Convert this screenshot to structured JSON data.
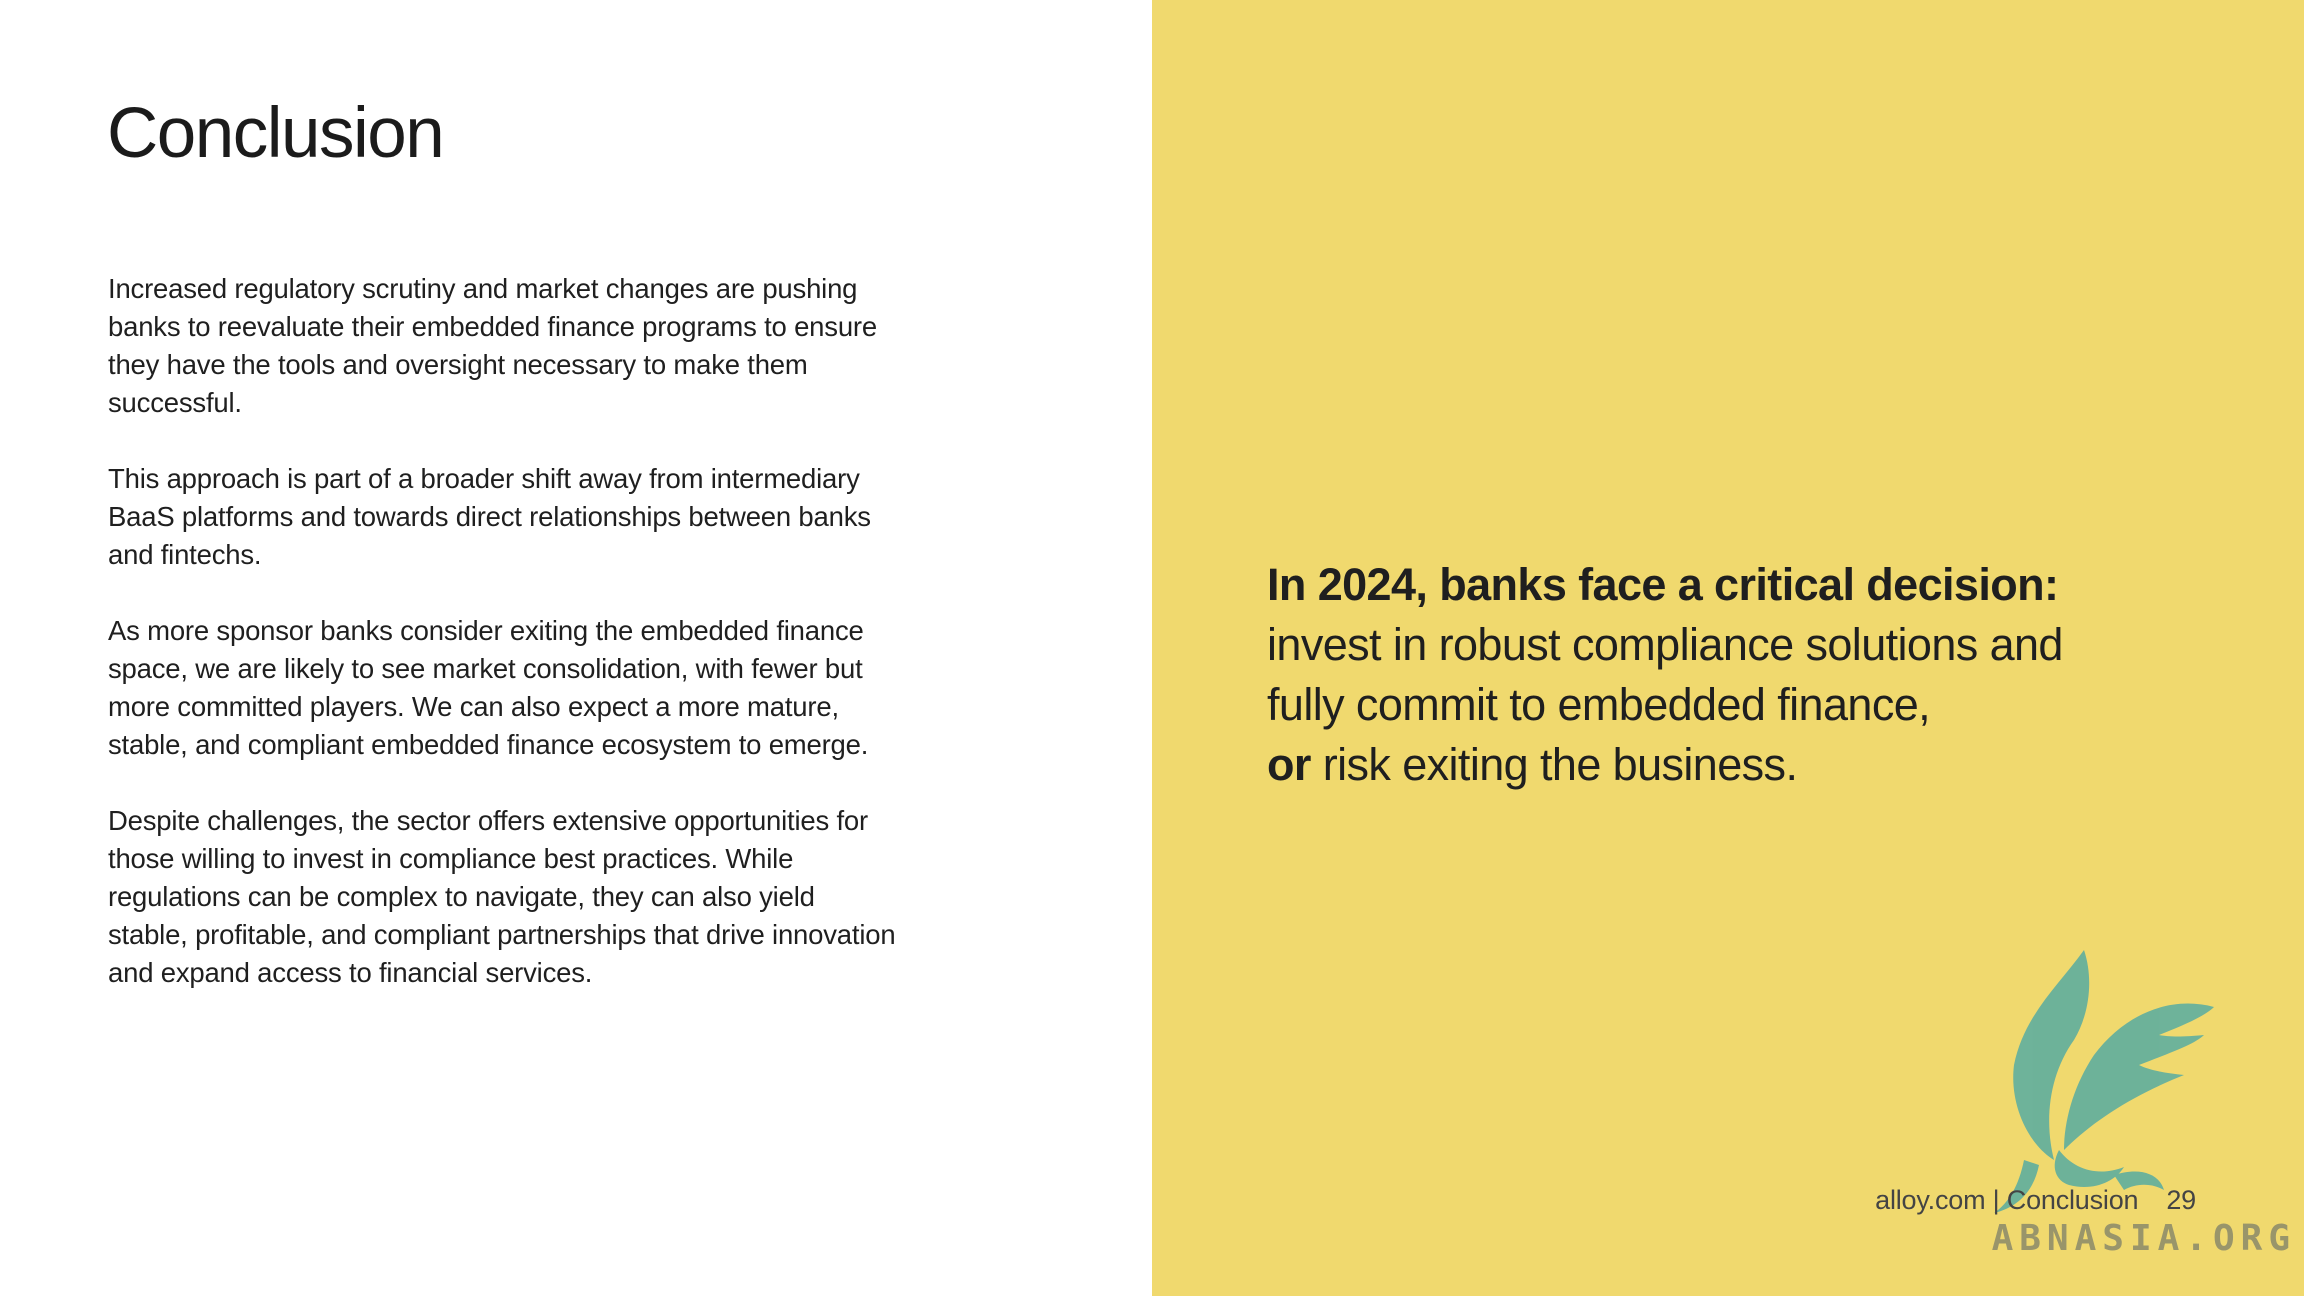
{
  "title": "Conclusion",
  "paragraphs": [
    "Increased regulatory scrutiny and market changes are pushing banks to reevaluate their embedded finance programs to ensure they have the tools and oversight necessary to make them successful.",
    "This approach is part of a broader shift away from intermediary BaaS platforms and towards direct relationships between banks and fintechs.",
    "As more sponsor banks consider exiting the embedded finance space, we are likely to see market consolidation, with fewer but more committed players. We can also expect a more mature, stable, and compliant embedded finance ecosystem to emerge.",
    "Despite challenges, the sector offers extensive opportunities for those willing to invest in compliance best practices. While regulations can be complex to navigate, they can also yield stable, profitable, and compliant partnerships that drive innovation and expand access to financial services."
  ],
  "callout": {
    "lead": "In 2024, banks face a critical decision:",
    "middle": "invest in robust compliance solutions and fully commit to embedded finance,",
    "or_word": "or",
    "end": "risk exiting the business."
  },
  "footer": {
    "source": "alloy.com | Conclusion",
    "page_number": "29"
  },
  "watermark": {
    "text": "ABNASIA.ORG",
    "logo_icon": "phoenix-bird-icon"
  },
  "colors": {
    "accent_yellow": "#f0d96e",
    "text": "#1f1f1f",
    "watermark_teal": "#5fae9e"
  }
}
